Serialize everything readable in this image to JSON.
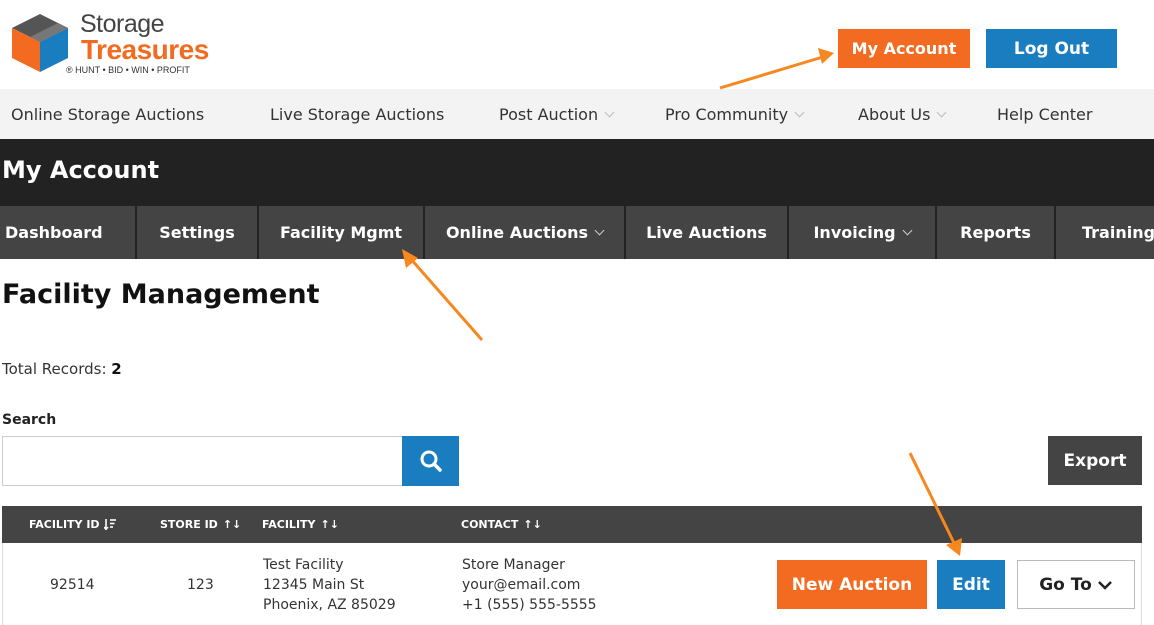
{
  "brand": {
    "name_line1": "Storage",
    "name_line2": "Treasures",
    "tagline": "® HUNT • BID • WIN • PROFIT",
    "colors": {
      "orange": "#f26b21",
      "blue": "#1a7dbf",
      "dark": "#222222",
      "nav_dark": "#444444"
    }
  },
  "header": {
    "my_account_label": "My Account",
    "logout_label": "Log Out"
  },
  "main_nav": [
    {
      "label": "Online Storage Auctions",
      "has_dropdown": false
    },
    {
      "label": "Live Storage Auctions",
      "has_dropdown": false
    },
    {
      "label": "Post Auction",
      "has_dropdown": true
    },
    {
      "label": "Pro Community",
      "has_dropdown": true
    },
    {
      "label": "About Us",
      "has_dropdown": true
    },
    {
      "label": "Help Center",
      "has_dropdown": false
    }
  ],
  "account_bar": {
    "title": "My Account"
  },
  "sub_nav": [
    {
      "label": "Dashboard",
      "has_dropdown": false
    },
    {
      "label": "Settings",
      "has_dropdown": false
    },
    {
      "label": "Facility Mgmt",
      "has_dropdown": false
    },
    {
      "label": "Online Auctions",
      "has_dropdown": true
    },
    {
      "label": "Live Auctions",
      "has_dropdown": false
    },
    {
      "label": "Invoicing",
      "has_dropdown": true
    },
    {
      "label": "Reports",
      "has_dropdown": false
    },
    {
      "label": "Training",
      "has_dropdown": false
    }
  ],
  "content": {
    "page_title": "Facility Management",
    "total_records_label": "Total Records:",
    "total_records_value": "2",
    "search_label": "Search",
    "search_value": "",
    "search_icon": "search-icon",
    "export_label": "Export"
  },
  "table": {
    "headers": [
      {
        "label": "FACILITY ID",
        "sort_icon": "sort-desc-icon"
      },
      {
        "label": "STORE ID",
        "sort_icon": "sort-both-icon"
      },
      {
        "label": "FACILITY",
        "sort_icon": "sort-both-icon"
      },
      {
        "label": "CONTACT",
        "sort_icon": "sort-both-icon"
      }
    ],
    "rows": [
      {
        "facility_id": "92514",
        "store_id": "123",
        "facility_name": "Test Facility",
        "facility_street": "12345 Main St",
        "facility_city": "Phoenix, AZ 85029",
        "contact_name": "Store Manager",
        "contact_email": "your@email.com",
        "contact_phone": "+1 (555) 555-5555",
        "new_auction_label": "New Auction",
        "edit_label": "Edit",
        "goto_label": "Go To"
      }
    ]
  }
}
